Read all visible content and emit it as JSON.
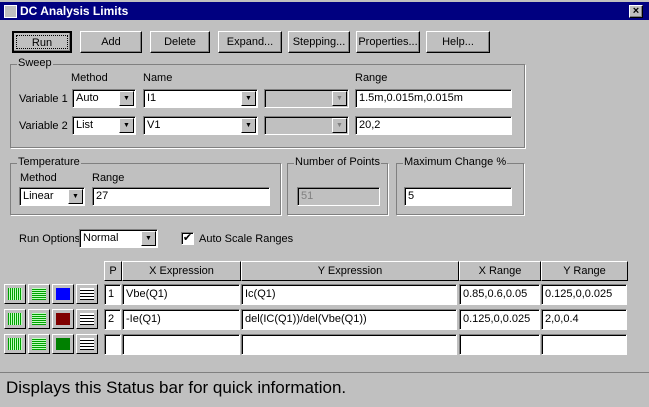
{
  "window": {
    "title": "DC Analysis Limits",
    "close": "×"
  },
  "toolbar": {
    "run": "Run",
    "add": "Add",
    "delete": "Delete",
    "expand": "Expand...",
    "stepping": "Stepping...",
    "properties": "Properties...",
    "help": "Help..."
  },
  "sweep": {
    "label": "Sweep",
    "method_header": "Method",
    "name_header": "Name",
    "range_header": "Range",
    "variables": [
      {
        "label": "Variable 1",
        "method": "Auto",
        "name": "I1",
        "param": "",
        "range": "1.5m,0.015m,0.015m"
      },
      {
        "label": "Variable 2",
        "method": "List",
        "name": "V1",
        "param": "",
        "range": "20,2"
      }
    ]
  },
  "temperature": {
    "label": "Temperature",
    "method_label": "Method",
    "range_label": "Range",
    "method": "Linear",
    "range": "27"
  },
  "points": {
    "label": "Number of Points",
    "value": "51"
  },
  "maxchange": {
    "label": "Maximum Change %",
    "value": "5"
  },
  "run_options": {
    "label": "Run Options",
    "value": "Normal",
    "auto_scale_label": "Auto Scale Ranges",
    "auto_scale_checked": true
  },
  "table": {
    "headers": [
      "P",
      "X Expression",
      "Y Expression",
      "X Range",
      "Y Range"
    ],
    "rows": [
      {
        "p": "1",
        "x": "Vbe(Q1)",
        "y": "Ic(Q1)",
        "xr": "0.85,0.6,0.05",
        "yr": "0.125,0,0.025",
        "color": "#0000ff"
      },
      {
        "p": "2",
        "x": "-Ie(Q1)",
        "y": "del(IC(Q1))/del(Vbe(Q1))",
        "xr": "0.125,0,0.025",
        "yr": "2,0,0.4",
        "color": "#800000"
      },
      {
        "p": "",
        "x": "",
        "y": "",
        "xr": "",
        "yr": "",
        "color": "#008000"
      }
    ]
  },
  "status": "Displays this Status bar for quick information."
}
